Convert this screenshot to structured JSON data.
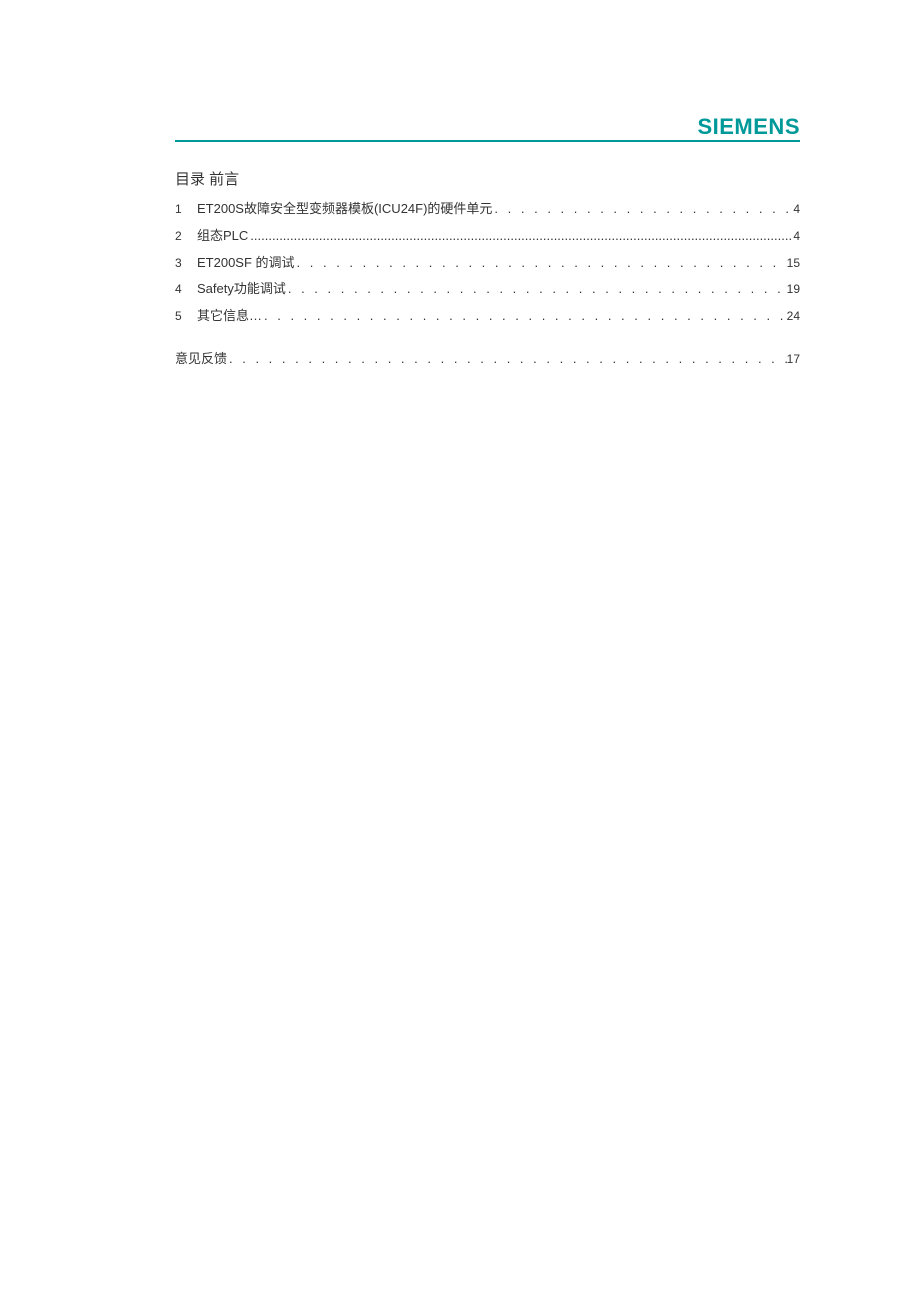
{
  "brand": "SIEMENS",
  "toc_heading": "目录  前言",
  "toc": [
    {
      "num": "1",
      "title": "ET200S故障安全型变频器模板(ICU24F)的硬件单元",
      "page": "4",
      "dense": false
    },
    {
      "num": "2",
      "title": "组态PLC",
      "page": "4",
      "dense": true
    },
    {
      "num": "3",
      "title": "ET200SF 的调试",
      "page": "15",
      "dense": false
    },
    {
      "num": "4",
      "title": "Safety功能调试",
      "page": "19",
      "dense": false
    },
    {
      "num": "5",
      "title": "其它信息…",
      "page": "24",
      "dense": false
    }
  ],
  "feedback": {
    "title": "意见反馈",
    "page": "17"
  },
  "leader_dots": ". . . . . . . . . . . . . . . . . . . . . . . . . . . . . . . . . . . . . . . . . . . . . . . . . . . . . . . . . . . . . . . . . . . . . . . . . . . . . . . . . . . . . . . . . . . . . . . . . . . . . . . . . . . . . . . . . . . . . . . . . . . . . . . . . . . . . . . . . . . . . . . . . . . . . .",
  "leader_dense": "........................................................................................................................................................................................................................................................"
}
